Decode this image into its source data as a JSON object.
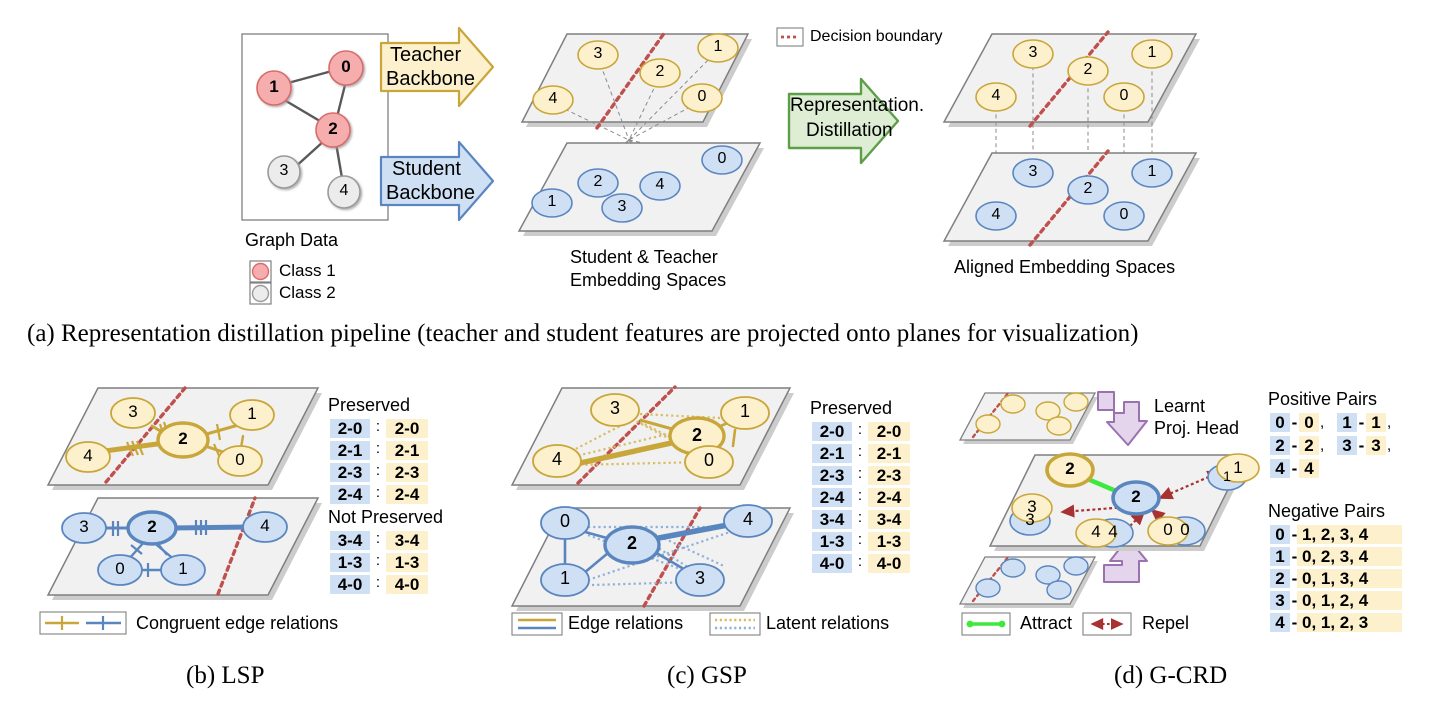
{
  "figure": {
    "caption_a": "(a) Representation distillation pipeline (teacher and student features are projected onto planes for visualization)",
    "caption_b": "(b) LSP",
    "caption_c": "(c) GSP",
    "caption_d": "(d) G-CRD"
  },
  "colors": {
    "teacher_fill": "#fdf0cd",
    "teacher_stroke": "#c9a63a",
    "student_fill": "#cfe0f5",
    "student_stroke": "#5a86bf",
    "class1_fill": "#f6adad",
    "class1_stroke": "#d96b6b",
    "class2_fill": "#ececec",
    "class2_stroke": "#9a9a9a",
    "plane_fill": "#f1f1f1",
    "plane_stroke": "#7f7f7f",
    "boundary_red": "#c0504d",
    "green_arrow_fill": "#ddeed4",
    "green_arrow_stroke": "#5f9e49",
    "purple_fill": "#e4d5ec",
    "purple_stroke": "#9b72b0",
    "attract_green": "#3ee83e",
    "repel_red": "#a83232",
    "highlight_blue": "#cfe0f5",
    "highlight_yellow": "#fdf0cd",
    "edge_gold": "#c9a63a",
    "edge_blue": "#5a86bf",
    "graph_edge": "#595959"
  },
  "panel_a": {
    "graph_box": {
      "title": "Graph Data",
      "nodes": [
        {
          "id": "0",
          "cls": "class1"
        },
        {
          "id": "1",
          "cls": "class1"
        },
        {
          "id": "2",
          "cls": "class1"
        },
        {
          "id": "3",
          "cls": "class2"
        },
        {
          "id": "4",
          "cls": "class2"
        }
      ],
      "edges": [
        [
          "1",
          "0"
        ],
        [
          "1",
          "2"
        ],
        [
          "0",
          "2"
        ],
        [
          "2",
          "3"
        ],
        [
          "2",
          "4"
        ]
      ],
      "legend": [
        {
          "label": "Class 1",
          "swatch": "class1"
        },
        {
          "label": "Class 2",
          "swatch": "class2"
        }
      ]
    },
    "arrows": {
      "teacher": "Teacher\nBackbone",
      "teacher_line1": "Teacher",
      "teacher_line2": "Backbone",
      "student_line1": "Student",
      "student_line2": "Backbone",
      "distill_line1": "Representation.",
      "distill_line2": "Distillation"
    },
    "decision_legend": "Decision boundary",
    "unaligned_label_l1": "Student & Teacher",
    "unaligned_label_l2": "Embedding Spaces",
    "aligned_label": "Aligned Embedding Spaces",
    "unaligned_teacher_nodes": [
      "3",
      "2",
      "1",
      "4",
      "0"
    ],
    "unaligned_student_nodes": [
      "0",
      "2",
      "4",
      "1",
      "3"
    ],
    "aligned_teacher_nodes": [
      "3",
      "2",
      "1",
      "4",
      "0"
    ],
    "aligned_student_nodes": [
      "3",
      "2",
      "1",
      "4",
      "0"
    ]
  },
  "panel_b": {
    "title": "(b) LSP",
    "teacher_nodes": [
      "3",
      "2",
      "1",
      "4",
      "0"
    ],
    "student_nodes": [
      "3",
      "2",
      "4",
      "0",
      "1"
    ],
    "preserved_heading": "Preserved",
    "preserved_pairs": [
      {
        "left": "2-0",
        "sep": ":",
        "right": "2-0"
      },
      {
        "left": "2-1",
        "sep": ":",
        "right": "2-1"
      },
      {
        "left": "2-3",
        "sep": ":",
        "right": "2-3"
      },
      {
        "left": "2-4",
        "sep": ":",
        "right": "2-4"
      }
    ],
    "not_preserved_heading": "Not Preserved",
    "not_preserved_pairs": [
      {
        "left": "3-4",
        "sep": ":",
        "right": "3-4"
      },
      {
        "left": "1-3",
        "sep": ":",
        "right": "1-3"
      },
      {
        "left": "4-0",
        "sep": ":",
        "right": "4-0"
      }
    ],
    "legend": [
      {
        "label": "Congruent edge relations"
      }
    ]
  },
  "panel_c": {
    "title": "(c) GSP",
    "teacher_nodes": [
      "3",
      "2",
      "1",
      "4",
      "0"
    ],
    "student_nodes": [
      "0",
      "2",
      "4",
      "1",
      "3"
    ],
    "preserved_heading": "Preserved",
    "preserved_pairs": [
      {
        "left": "2-0",
        "sep": ":",
        "right": "2-0"
      },
      {
        "left": "2-1",
        "sep": ":",
        "right": "2-1"
      },
      {
        "left": "2-3",
        "sep": ":",
        "right": "2-3"
      },
      {
        "left": "2-4",
        "sep": ":",
        "right": "2-4"
      },
      {
        "left": "3-4",
        "sep": ":",
        "right": "3-4"
      },
      {
        "left": "1-3",
        "sep": ":",
        "right": "1-3"
      },
      {
        "left": "4-0",
        "sep": ":",
        "right": "4-0"
      }
    ],
    "legend": [
      {
        "label": "Edge relations"
      },
      {
        "label": "Latent relations"
      }
    ]
  },
  "panel_d": {
    "title": "(d) G-CRD",
    "proj_head_l1": "Learnt",
    "proj_head_l2": "Proj. Head",
    "teacher_nodes": [
      "2",
      "3",
      "4",
      "0",
      "1"
    ],
    "student_nodes": [
      "2",
      "3",
      "4",
      "0",
      "1"
    ],
    "positive_heading": "Positive Pairs",
    "positive_rows": [
      [
        {
          "a": "0",
          "b": "0",
          "tail": ","
        },
        {
          "a": "1",
          "b": "1",
          "tail": ","
        }
      ],
      [
        {
          "a": "2",
          "b": "2",
          "tail": ","
        },
        {
          "a": "3",
          "b": "3",
          "tail": ","
        }
      ],
      [
        {
          "a": "4",
          "b": "4",
          "tail": ""
        }
      ]
    ],
    "negative_heading": "Negative Pairs",
    "negative_rows": [
      {
        "a": "0",
        "b": "1, 2, 3, 4"
      },
      {
        "a": "1",
        "b": "0, 2, 3, 4"
      },
      {
        "a": "2",
        "b": "0, 1, 3, 4"
      },
      {
        "a": "3",
        "b": "0, 1, 2, 4"
      },
      {
        "a": "4",
        "b": "0, 1, 2, 3"
      }
    ],
    "legend": [
      {
        "label": "Attract"
      },
      {
        "label": "Repel"
      }
    ]
  }
}
